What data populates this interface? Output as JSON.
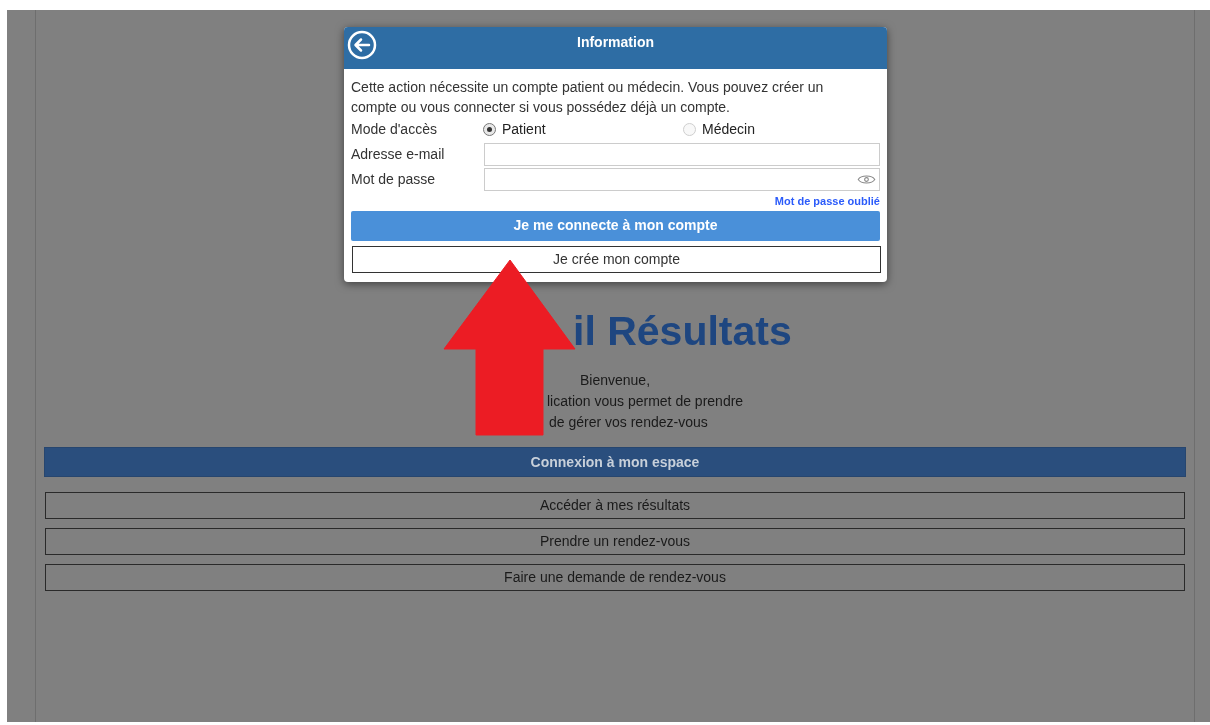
{
  "modal": {
    "title": "Information",
    "message": "Cette action nécessite un compte patient ou médecin. Vous pouvez créer un compte ou vous connecter si vous possédez déjà un compte.",
    "access_mode": {
      "label": "Mode d'accès",
      "options": [
        {
          "label": "Patient",
          "selected": true
        },
        {
          "label": "Médecin",
          "selected": false
        }
      ]
    },
    "email": {
      "label": "Adresse e-mail"
    },
    "password": {
      "label": "Mot de passe"
    },
    "forgot_link": "Mot de passe oublié",
    "login_button": "Je me connecte à mon compte",
    "create_button": "Je crée mon compte"
  },
  "page": {
    "title": "il Résultats",
    "welcome": "Bienvenue,",
    "intro_lines": [
      "lication vous permet de prendre",
      "de gérer vos rendez-vous"
    ],
    "banner": "Connexion à mon espace",
    "buttons": [
      "Accéder à mes résultats",
      "Prendre un rendez-vous",
      "Faire une demande de rendez-vous"
    ]
  }
}
